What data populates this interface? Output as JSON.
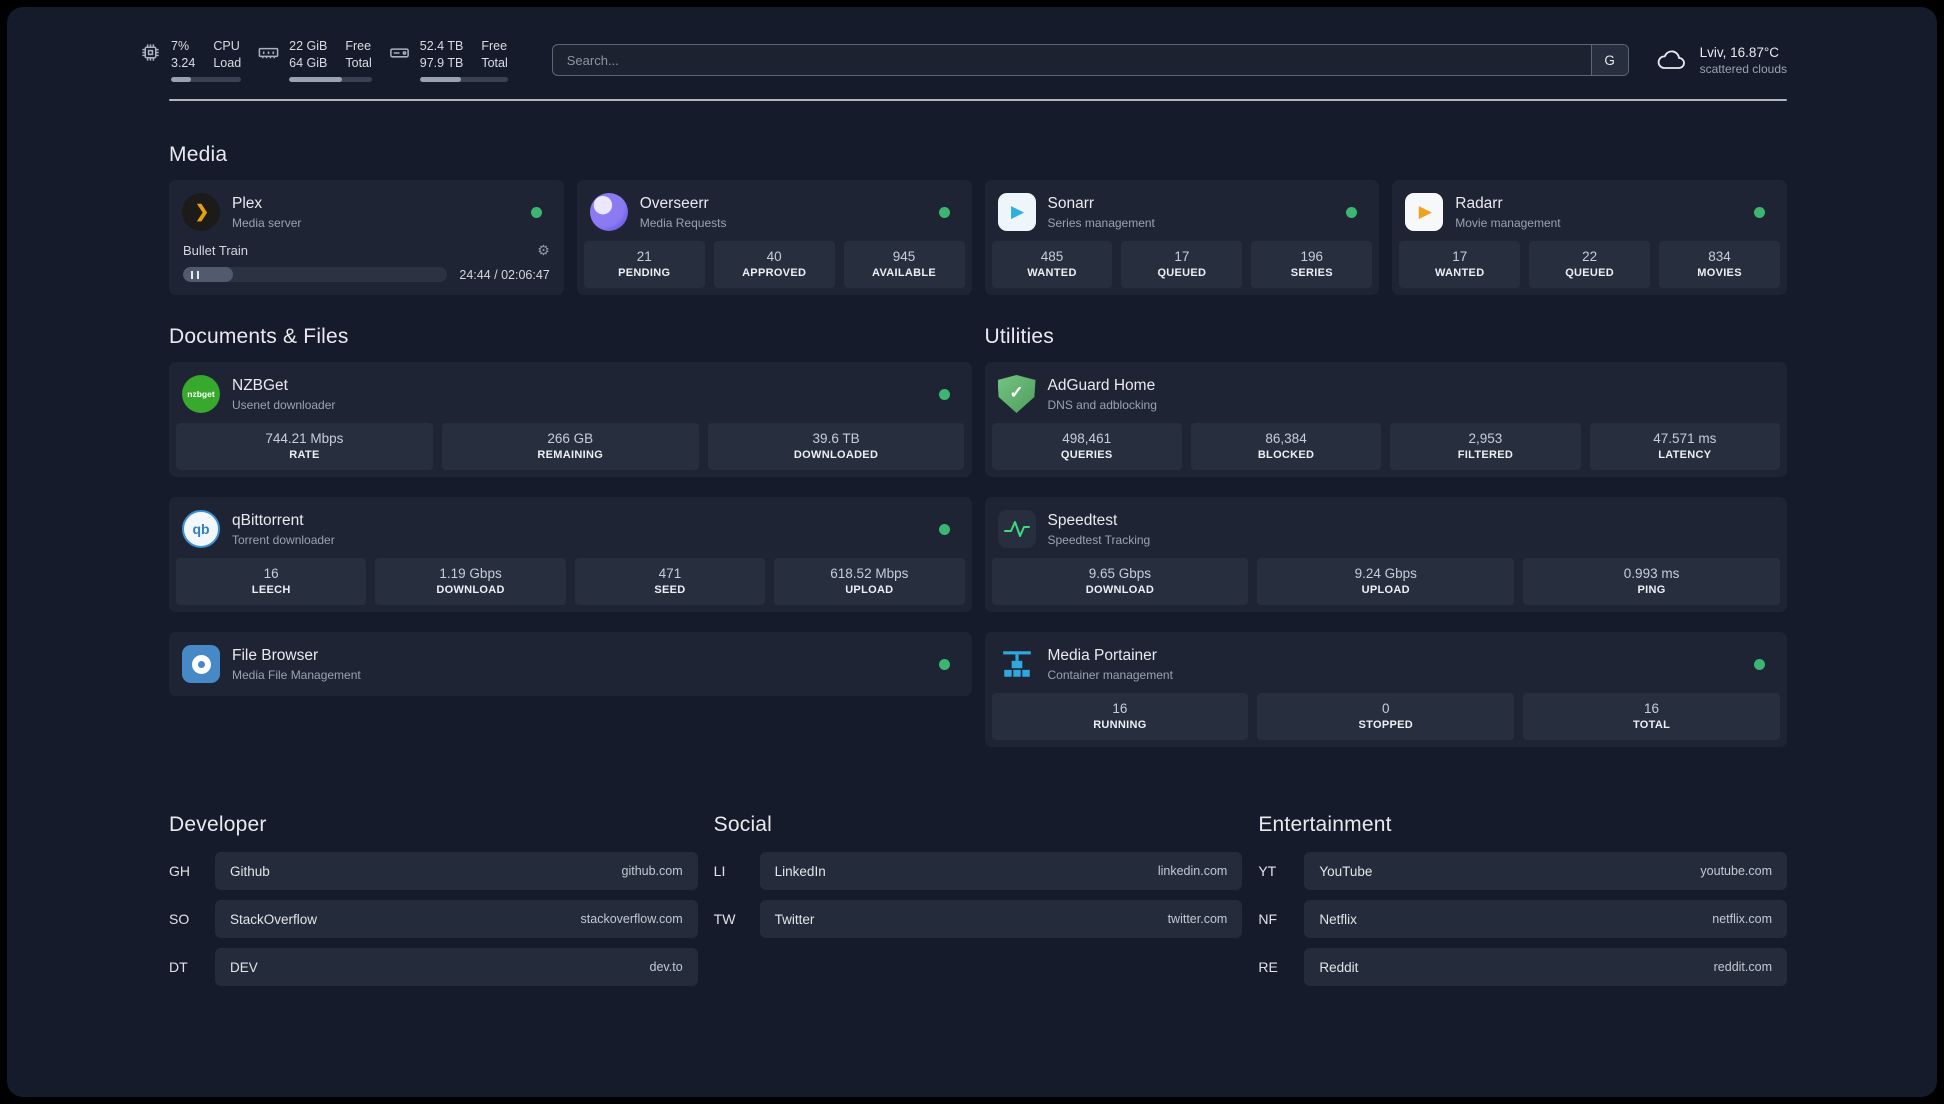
{
  "colors": {
    "status_online": "#3cb573",
    "accent_gold": "#e5a00d",
    "speedtest_line": "#3fd97f"
  },
  "icons": {
    "plex_chevron": "❯",
    "play": "▶",
    "check": "✓",
    "gear": "⚙",
    "nzbget": "nzbget",
    "qbittorrent": "qb"
  },
  "header": {
    "cpu": {
      "percent": "7%",
      "load": "3.24",
      "label_line1": "CPU",
      "label_line2": "Load"
    },
    "memory": {
      "free": "22 GiB",
      "total": "64 GiB",
      "label_line1": "Free",
      "label_line2": "Total"
    },
    "disk": {
      "free": "52.4 TB",
      "total": "97.9 TB",
      "label_line1": "Free",
      "label_line2": "Total"
    },
    "search": {
      "placeholder": "Search...",
      "provider_button": "G"
    },
    "weather": {
      "location": "Lviv, 16.87°C",
      "condition": "scattered clouds"
    }
  },
  "sections": {
    "media": {
      "title": "Media",
      "cards": [
        {
          "name": "Plex",
          "description": "Media server",
          "player": {
            "track_title": "Bullet Train",
            "time": "24:44 / 02:06:47"
          }
        },
        {
          "name": "Overseerr",
          "description": "Media Requests",
          "stats": [
            {
              "value": "21",
              "label": "PENDING"
            },
            {
              "value": "40",
              "label": "APPROVED"
            },
            {
              "value": "945",
              "label": "AVAILABLE"
            }
          ]
        },
        {
          "name": "Sonarr",
          "description": "Series management",
          "stats": [
            {
              "value": "485",
              "label": "WANTED"
            },
            {
              "value": "17",
              "label": "QUEUED"
            },
            {
              "value": "196",
              "label": "SERIES"
            }
          ]
        },
        {
          "name": "Radarr",
          "description": "Movie management",
          "stats": [
            {
              "value": "17",
              "label": "WANTED"
            },
            {
              "value": "22",
              "label": "QUEUED"
            },
            {
              "value": "834",
              "label": "MOVIES"
            }
          ]
        }
      ]
    },
    "documents": {
      "title": "Documents & Files",
      "cards": [
        {
          "name": "NZBGet",
          "description": "Usenet downloader",
          "stats": [
            {
              "value": "744.21 Mbps",
              "label": "RATE"
            },
            {
              "value": "266 GB",
              "label": "REMAINING"
            },
            {
              "value": "39.6 TB",
              "label": "DOWNLOADED"
            }
          ]
        },
        {
          "name": "qBittorrent",
          "description": "Torrent downloader",
          "stats": [
            {
              "value": "16",
              "label": "LEECH"
            },
            {
              "value": "1.19 Gbps",
              "label": "DOWNLOAD"
            },
            {
              "value": "471",
              "label": "SEED"
            },
            {
              "value": "618.52 Mbps",
              "label": "UPLOAD"
            }
          ]
        },
        {
          "name": "File Browser",
          "description": "Media File Management"
        }
      ]
    },
    "utilities": {
      "title": "Utilities",
      "cards": [
        {
          "name": "AdGuard Home",
          "description": "DNS and adblocking",
          "stats": [
            {
              "value": "498,461",
              "label": "QUERIES"
            },
            {
              "value": "86,384",
              "label": "BLOCKED"
            },
            {
              "value": "2,953",
              "label": "FILTERED"
            },
            {
              "value": "47.571 ms",
              "label": "LATENCY"
            }
          ]
        },
        {
          "name": "Speedtest",
          "description": "Speedtest Tracking",
          "stats": [
            {
              "value": "9.65 Gbps",
              "label": "DOWNLOAD"
            },
            {
              "value": "9.24 Gbps",
              "label": "UPLOAD"
            },
            {
              "value": "0.993 ms",
              "label": "PING"
            }
          ]
        },
        {
          "name": "Media Portainer",
          "description": "Container management",
          "stats": [
            {
              "value": "16",
              "label": "RUNNING"
            },
            {
              "value": "0",
              "label": "STOPPED"
            },
            {
              "value": "16",
              "label": "TOTAL"
            }
          ]
        }
      ]
    },
    "bookmarks": {
      "groups": [
        {
          "title": "Developer",
          "items": [
            {
              "abbr": "GH",
              "name": "Github",
              "url": "github.com"
            },
            {
              "abbr": "SO",
              "name": "StackOverflow",
              "url": "stackoverflow.com"
            },
            {
              "abbr": "DT",
              "name": "DEV",
              "url": "dev.to"
            }
          ]
        },
        {
          "title": "Social",
          "items": [
            {
              "abbr": "LI",
              "name": "LinkedIn",
              "url": "linkedin.com"
            },
            {
              "abbr": "TW",
              "name": "Twitter",
              "url": "twitter.com"
            }
          ]
        },
        {
          "title": "Entertainment",
          "items": [
            {
              "abbr": "YT",
              "name": "YouTube",
              "url": "youtube.com"
            },
            {
              "abbr": "NF",
              "name": "Netflix",
              "url": "netflix.com"
            },
            {
              "abbr": "RE",
              "name": "Reddit",
              "url": "reddit.com"
            }
          ]
        }
      ]
    }
  }
}
